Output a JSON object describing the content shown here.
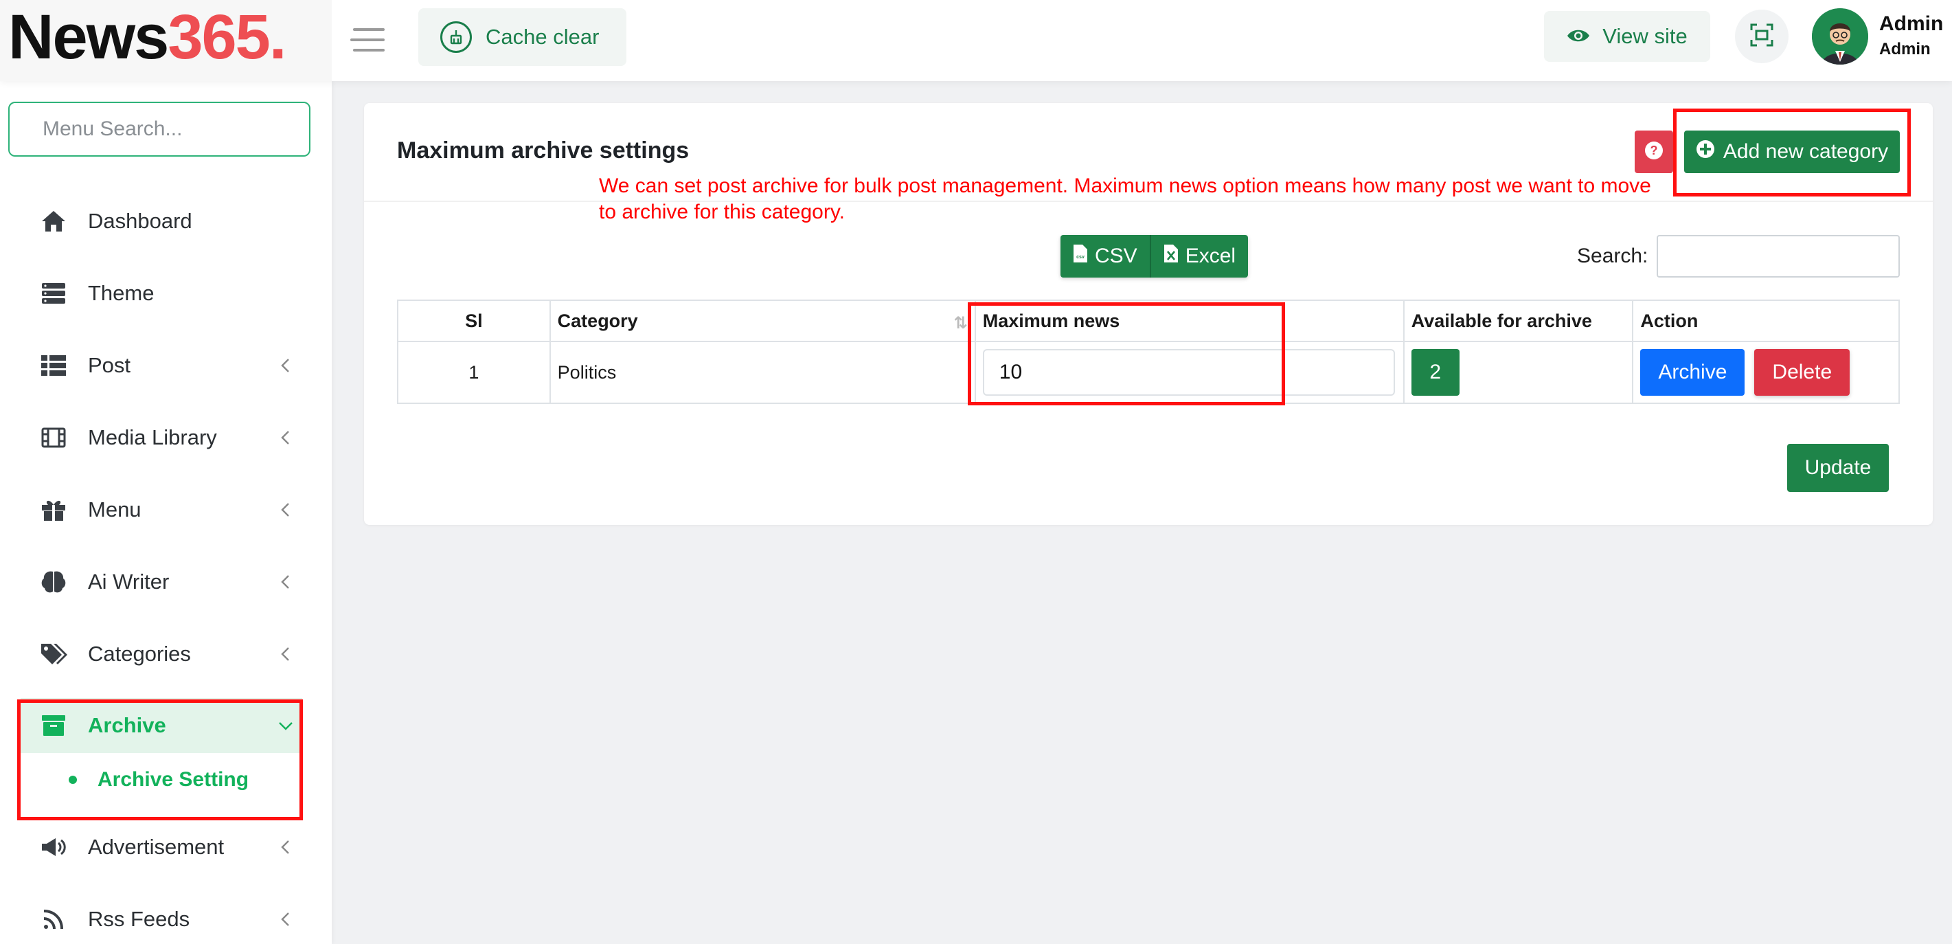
{
  "header": {
    "logo_main": "News",
    "logo_accent": "365.",
    "cache_clear_label": "Cache clear",
    "view_site_label": "View site",
    "user_name": "Admin",
    "user_role": "Admin"
  },
  "sidebar": {
    "search_placeholder": "Menu Search...",
    "items": [
      {
        "label": "Dashboard",
        "icon": "home-icon"
      },
      {
        "label": "Theme",
        "icon": "theme-icon"
      },
      {
        "label": "Post",
        "icon": "list-icon"
      },
      {
        "label": "Media Library",
        "icon": "film-icon"
      },
      {
        "label": "Menu",
        "icon": "gift-icon"
      },
      {
        "label": "Ai Writer",
        "icon": "brain-icon"
      },
      {
        "label": "Categories",
        "icon": "tags-icon"
      },
      {
        "label": "Archive",
        "icon": "archive-icon"
      },
      {
        "label": "Advertisement",
        "icon": "megaphone-icon"
      },
      {
        "label": "Rss Feeds",
        "icon": "rss-icon"
      }
    ],
    "active_submenu": "Archive Setting"
  },
  "main": {
    "title": "Maximum archive settings",
    "annotation": "We can set post archive for bulk post management. Maximum news option means how many post we want to move to archive for this category.",
    "add_category_label": "Add new category",
    "export_buttons": [
      "CSV",
      "Excel"
    ],
    "search_label": "Search:",
    "search_value": "",
    "table": {
      "headers": [
        "Sl",
        "Category",
        "Maximum news",
        "Available for archive",
        "Action"
      ],
      "rows": [
        {
          "sl": "1",
          "category": "Politics",
          "max_news": "10",
          "available": "2",
          "archive_label": "Archive",
          "delete_label": "Delete"
        }
      ]
    },
    "update_label": "Update"
  },
  "colors": {
    "brand_green": "#1e8449",
    "logo_accent": "#ee4e52",
    "active_green": "#12b25b",
    "annotation_red": "#ff0000"
  }
}
